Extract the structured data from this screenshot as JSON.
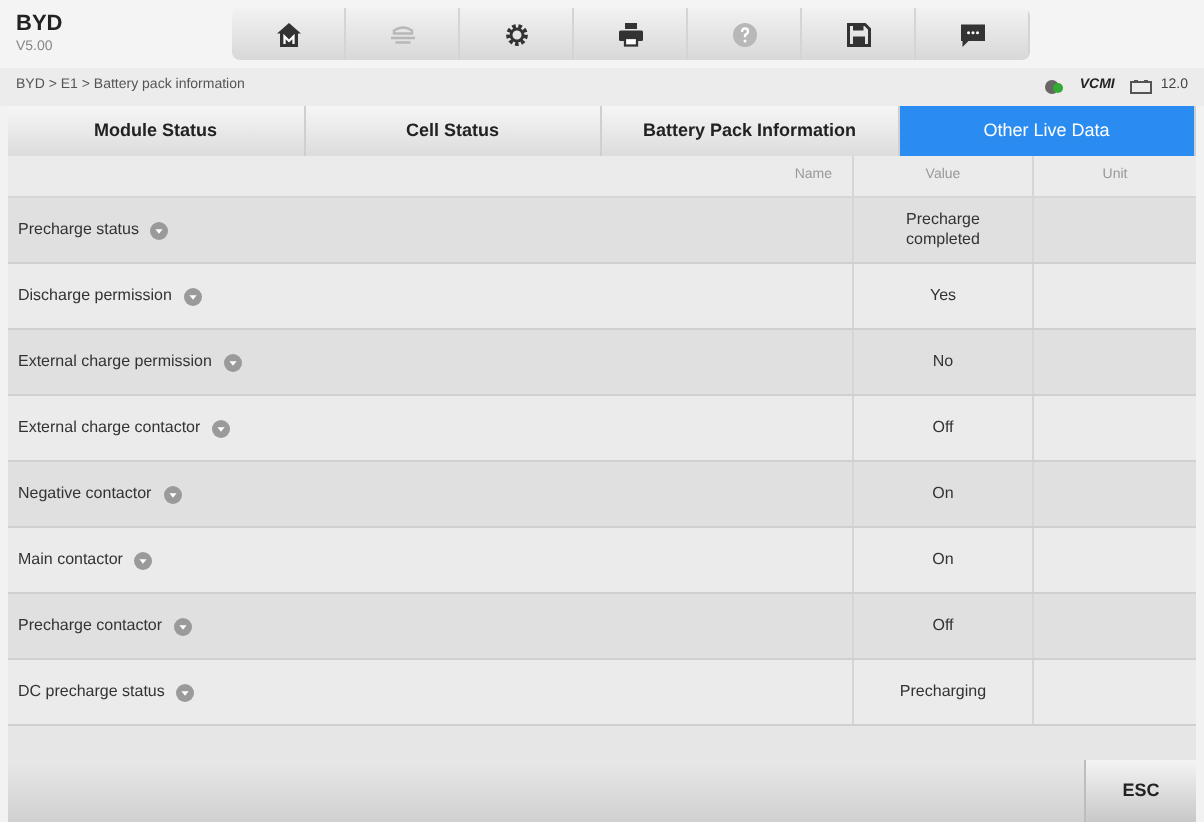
{
  "header": {
    "title": "BYD",
    "version": "V5.00"
  },
  "toolbar": [
    {
      "kind": "home",
      "disabled": false
    },
    {
      "kind": "vehicle",
      "disabled": true
    },
    {
      "kind": "settings",
      "disabled": false
    },
    {
      "kind": "print",
      "disabled": false
    },
    {
      "kind": "help",
      "disabled": true
    },
    {
      "kind": "save",
      "disabled": false
    },
    {
      "kind": "message",
      "disabled": false
    }
  ],
  "breadcrumb": "BYD > E1 > Battery pack information",
  "status": {
    "vci": "VCMI",
    "voltage": "12.0"
  },
  "tabs": [
    {
      "label": "Module Status",
      "selected": false
    },
    {
      "label": "Cell Status",
      "selected": false
    },
    {
      "label": "Battery Pack Information",
      "selected": false
    },
    {
      "label": "Other Live Data",
      "selected": true
    }
  ],
  "table": {
    "columns": [
      "Name",
      "Value",
      "Unit"
    ],
    "rows": [
      {
        "name": "Precharge status",
        "value": "Precharge completed"
      },
      {
        "name": "Discharge permission",
        "value": "Yes"
      },
      {
        "name": "External charge permission",
        "value": "No"
      },
      {
        "name": "External charge contactor",
        "value": "Off"
      },
      {
        "name": "Negative contactor",
        "value": "On"
      },
      {
        "name": "Main contactor",
        "value": "On"
      },
      {
        "name": "Precharge contactor",
        "value": "Off"
      },
      {
        "name": "DC precharge status",
        "value": "Precharging"
      }
    ]
  },
  "footer": {
    "button": "ESC"
  }
}
